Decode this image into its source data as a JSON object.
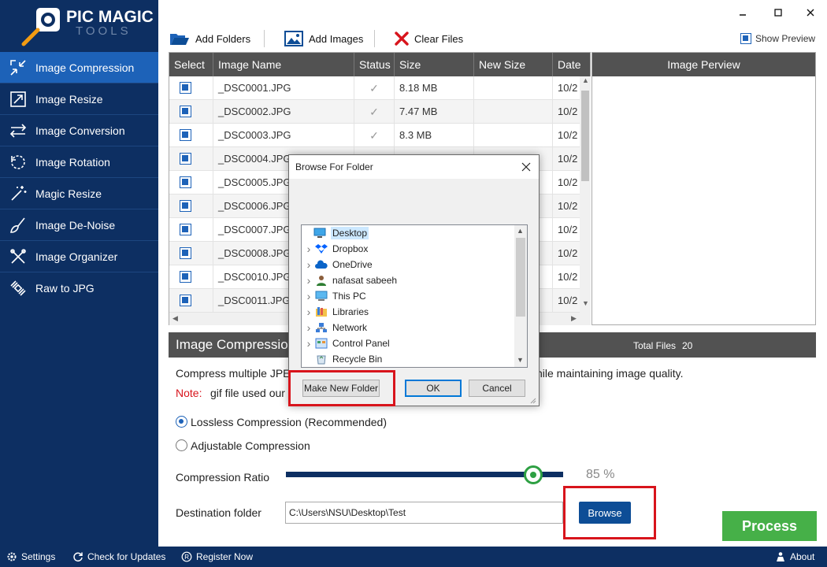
{
  "logo": {
    "line1": "PIC MAGIC",
    "line2": "TOOLS"
  },
  "sidebar": {
    "items": [
      {
        "label": "Image Compression",
        "icon": "compress-icon",
        "active": true
      },
      {
        "label": "Image Resize",
        "icon": "resize-icon",
        "active": false
      },
      {
        "label": "Image Conversion",
        "icon": "convert-arrows-icon",
        "active": false
      },
      {
        "label": "Image Rotation",
        "icon": "rotate-icon",
        "active": false
      },
      {
        "label": "Magic Resize",
        "icon": "magic-wand-icon",
        "active": false
      },
      {
        "label": "Image De-Noise",
        "icon": "broom-icon",
        "active": false
      },
      {
        "label": "Image Organizer",
        "icon": "tools-icon",
        "active": false
      },
      {
        "label": "Raw to JPG",
        "icon": "satellite-icon",
        "active": false
      }
    ]
  },
  "toolbar": {
    "add_folders": "Add Folders",
    "add_images": "Add Images",
    "clear_files": "Clear Files",
    "show_preview": "Show Preview"
  },
  "table": {
    "columns": [
      "Select",
      "Image Name",
      "Status",
      "Size",
      "New Size",
      "Date"
    ],
    "rows": [
      {
        "name": "_DSC0001.JPG",
        "status": "✓",
        "size": "8.18 MB",
        "new_size": "",
        "date": "10/2"
      },
      {
        "name": "_DSC0002.JPG",
        "status": "✓",
        "size": "7.47 MB",
        "new_size": "",
        "date": "10/2"
      },
      {
        "name": "_DSC0003.JPG",
        "status": "✓",
        "size": "8.3 MB",
        "new_size": "",
        "date": "10/2"
      },
      {
        "name": "_DSC0004.JPG",
        "status": "",
        "size": "",
        "new_size": "",
        "date": "10/2"
      },
      {
        "name": "_DSC0005.JPG",
        "status": "",
        "size": "",
        "new_size": "",
        "date": "10/2"
      },
      {
        "name": "_DSC0006.JPG",
        "status": "",
        "size": "",
        "new_size": "",
        "date": "10/2"
      },
      {
        "name": "_DSC0007.JPG",
        "status": "",
        "size": "",
        "new_size": "",
        "date": "10/2"
      },
      {
        "name": "_DSC0008.JPG",
        "status": "",
        "size": "",
        "new_size": "",
        "date": "10/2"
      },
      {
        "name": "_DSC0010.JPG",
        "status": "",
        "size": "",
        "new_size": "",
        "date": "10/2"
      },
      {
        "name": "_DSC0011.JPG",
        "status": "",
        "size": "",
        "new_size": "",
        "date": "10/2"
      }
    ]
  },
  "preview": {
    "title": "Image Perview"
  },
  "section": {
    "title": "Image Compression",
    "total_files_label": "Total Files",
    "total_files_value": "20",
    "desc_left": "Compress multiple JPEG",
    "desc_right": "hile maintaining image quality.",
    "note_label": "Note:",
    "note_text": "gif file used our"
  },
  "options": {
    "lossless": "Lossless Compression (Recommended)",
    "adjustable": "Adjustable Compression",
    "selected": "lossless"
  },
  "compression": {
    "label": "Compression Ratio",
    "value_text": "85 %",
    "value": 85
  },
  "destination": {
    "label": "Destination folder",
    "value": "C:\\Users\\NSU\\Desktop\\Test",
    "browse": "Browse"
  },
  "process": "Process",
  "statusbar": {
    "settings": "Settings",
    "updates": "Check for Updates",
    "register": "Register Now",
    "about": "About"
  },
  "dialog": {
    "title": "Browse For Folder",
    "tree": [
      {
        "label": "Desktop",
        "icon": "desktop-icon",
        "expandable": false,
        "selected": true,
        "indent": 0
      },
      {
        "label": "Dropbox",
        "icon": "dropbox-icon",
        "expandable": true,
        "selected": false,
        "indent": 1
      },
      {
        "label": "OneDrive",
        "icon": "onedrive-cloud-icon",
        "expandable": true,
        "selected": false,
        "indent": 1
      },
      {
        "label": "nafasat sabeeh",
        "icon": "user-icon",
        "expandable": true,
        "selected": false,
        "indent": 1
      },
      {
        "label": "This PC",
        "icon": "computer-icon",
        "expandable": true,
        "selected": false,
        "indent": 1
      },
      {
        "label": "Libraries",
        "icon": "libraries-icon",
        "expandable": true,
        "selected": false,
        "indent": 1
      },
      {
        "label": "Network",
        "icon": "network-icon",
        "expandable": true,
        "selected": false,
        "indent": 1
      },
      {
        "label": "Control Panel",
        "icon": "control-panel-icon",
        "expandable": true,
        "selected": false,
        "indent": 1
      },
      {
        "label": "Recycle Bin",
        "icon": "recycle-bin-icon",
        "expandable": false,
        "selected": false,
        "indent": 1
      }
    ],
    "make_new_folder": "Make New Folder",
    "ok": "OK",
    "cancel": "Cancel"
  },
  "colors": {
    "sidebar": "#0d2f62",
    "sidebar_active": "#1d62b8",
    "header_gray": "#525252",
    "accent_blue": "#0d4d96",
    "process_green": "#46b048",
    "highlight_red": "#d8141c"
  }
}
